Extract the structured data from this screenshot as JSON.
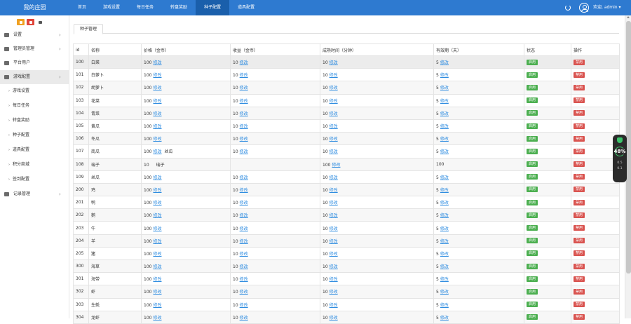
{
  "header": {
    "logo": "我的庄园",
    "nav": [
      "首页",
      "游戏设置",
      "每日任务",
      "转盘奖励",
      "种子配置",
      "道具配置"
    ],
    "active_nav_index": 4,
    "user": "欢迎, admin ▾",
    "refresh_icon": "refresh-icon",
    "avatar_icon": "user-avatar-icon"
  },
  "sidebar": {
    "tools": [
      {
        "icon": "home-icon",
        "color": "#f0a020"
      },
      {
        "icon": "close-icon",
        "color": "#e0453a"
      },
      {
        "icon": "grid-icon",
        "color": "#555555"
      }
    ],
    "items": [
      {
        "label": "设置",
        "icon": "gear-icon",
        "chevron": "›"
      },
      {
        "label": "管理员管理",
        "icon": "user-icon",
        "chevron": "›"
      },
      {
        "label": "平台用户",
        "icon": "person-icon",
        "chevron": ""
      },
      {
        "label": "游戏配置",
        "icon": "gamepad-icon",
        "chevron": "›",
        "active": true
      }
    ],
    "subitems": [
      "游戏设置",
      "每日任务",
      "转盘奖励",
      "种子配置",
      "道具配置",
      "积分商城",
      "签到配置"
    ],
    "last_item": {
      "label": "记录管理",
      "icon": "list-icon",
      "chevron": "›"
    }
  },
  "tabs": {
    "active": "种子管理"
  },
  "table": {
    "headers": [
      "id",
      "名称",
      "价格（金币）",
      "收益（金币）",
      "成熟时间（分钟）",
      "有效期（天）",
      "状态",
      "操作"
    ],
    "edit_label": "修改",
    "status_label": "启用",
    "action_label": "禁用",
    "rows": [
      {
        "id": "100",
        "name": "白菜",
        "price": "100",
        "profit": "10",
        "mature": "10",
        "valid": "5"
      },
      {
        "id": "101",
        "name": "白萝卜",
        "price": "100",
        "profit": "10",
        "mature": "10",
        "valid": "5"
      },
      {
        "id": "102",
        "name": "胡萝卜",
        "price": "100",
        "profit": "10",
        "mature": "10",
        "valid": "5"
      },
      {
        "id": "103",
        "name": "花菜",
        "price": "100",
        "profit": "10",
        "mature": "10",
        "valid": "5"
      },
      {
        "id": "104",
        "name": "青菜",
        "price": "100",
        "profit": "10",
        "mature": "10",
        "valid": "5"
      },
      {
        "id": "105",
        "name": "黄瓜",
        "price": "100",
        "profit": "10",
        "mature": "10",
        "valid": "5"
      },
      {
        "id": "106",
        "name": "冬瓜",
        "price": "100",
        "profit": "10",
        "mature": "10",
        "valid": "5"
      },
      {
        "id": "107",
        "name": "南瓜",
        "price": "100",
        "profit": "10",
        "mature": "10",
        "valid": "5",
        "overlay": "丝瓜"
      },
      {
        "id": "108",
        "name": "瑞子",
        "price": "10",
        "price_extra": "瑞子",
        "profit": "",
        "mature": "100",
        "valid": "100",
        "price_no_link": true,
        "profit_no_link": true,
        "valid_no_link": true
      },
      {
        "id": "109",
        "name": "丝瓜",
        "price": "100",
        "profit": "10",
        "mature": "10",
        "valid": "5"
      },
      {
        "id": "200",
        "name": "鸡",
        "price": "100",
        "profit": "10",
        "mature": "10",
        "valid": "5"
      },
      {
        "id": "201",
        "name": "鸭",
        "price": "100",
        "profit": "10",
        "mature": "10",
        "valid": "5"
      },
      {
        "id": "202",
        "name": "鹅",
        "price": "100",
        "profit": "10",
        "mature": "10",
        "valid": "5"
      },
      {
        "id": "203",
        "name": "牛",
        "price": "100",
        "profit": "10",
        "mature": "10",
        "valid": "5"
      },
      {
        "id": "204",
        "name": "羊",
        "price": "100",
        "profit": "10",
        "mature": "10",
        "valid": "5"
      },
      {
        "id": "205",
        "name": "猪",
        "price": "100",
        "profit": "10",
        "mature": "10",
        "valid": "5"
      },
      {
        "id": "300",
        "name": "海草",
        "price": "100",
        "profit": "10",
        "mature": "10",
        "valid": "5"
      },
      {
        "id": "301",
        "name": "海带",
        "price": "100",
        "profit": "10",
        "mature": "10",
        "valid": "5"
      },
      {
        "id": "302",
        "name": "虾",
        "price": "100",
        "profit": "10",
        "mature": "10",
        "valid": "5"
      },
      {
        "id": "303",
        "name": "生蚝",
        "price": "100",
        "profit": "10",
        "mature": "10",
        "valid": "5"
      },
      {
        "id": "304",
        "name": "龙虾",
        "price": "100",
        "profit": "10",
        "mature": "10",
        "valid": "5"
      }
    ]
  },
  "float_widget": {
    "value": "48",
    "unit": "%",
    "line1": "0.5",
    "line2": "0.1",
    "shield_icon": "shield-icon"
  }
}
